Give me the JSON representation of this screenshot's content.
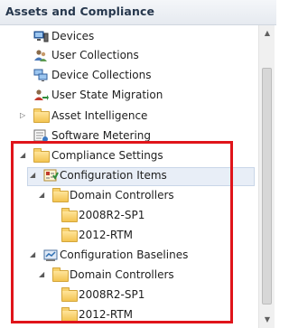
{
  "header": {
    "title": "Assets and Compliance"
  },
  "tree": {
    "items": [
      {
        "label": "Devices",
        "icon": "devices-icon"
      },
      {
        "label": "User Collections",
        "icon": "user-collections-icon"
      },
      {
        "label": "Device Collections",
        "icon": "device-collections-icon"
      },
      {
        "label": "User State Migration",
        "icon": "user-state-migration-icon"
      },
      {
        "label": "Asset Intelligence",
        "icon": "folder-icon",
        "expander": "collapsed"
      },
      {
        "label": "Software Metering",
        "icon": "software-metering-icon"
      },
      {
        "label": "Compliance Settings",
        "icon": "folder-icon",
        "expander": "expanded"
      },
      {
        "label": "Configuration Items",
        "icon": "configuration-items-icon",
        "expander": "expanded",
        "selected": true
      },
      {
        "label": "Domain Controllers",
        "icon": "folder-icon",
        "expander": "expanded"
      },
      {
        "label": "2008R2-SP1",
        "icon": "folder-icon"
      },
      {
        "label": "2012-RTM",
        "icon": "folder-icon"
      },
      {
        "label": "Configuration Baselines",
        "icon": "configuration-baselines-icon",
        "expander": "expanded"
      },
      {
        "label": "Domain Controllers",
        "icon": "folder-icon",
        "expander": "expanded"
      },
      {
        "label": "2008R2-SP1",
        "icon": "folder-icon"
      },
      {
        "label": "2012-RTM",
        "icon": "folder-icon"
      }
    ]
  },
  "colors": {
    "highlight_box": "#e0141a",
    "selection": "#e8eef7",
    "folder": "#f3c451"
  }
}
